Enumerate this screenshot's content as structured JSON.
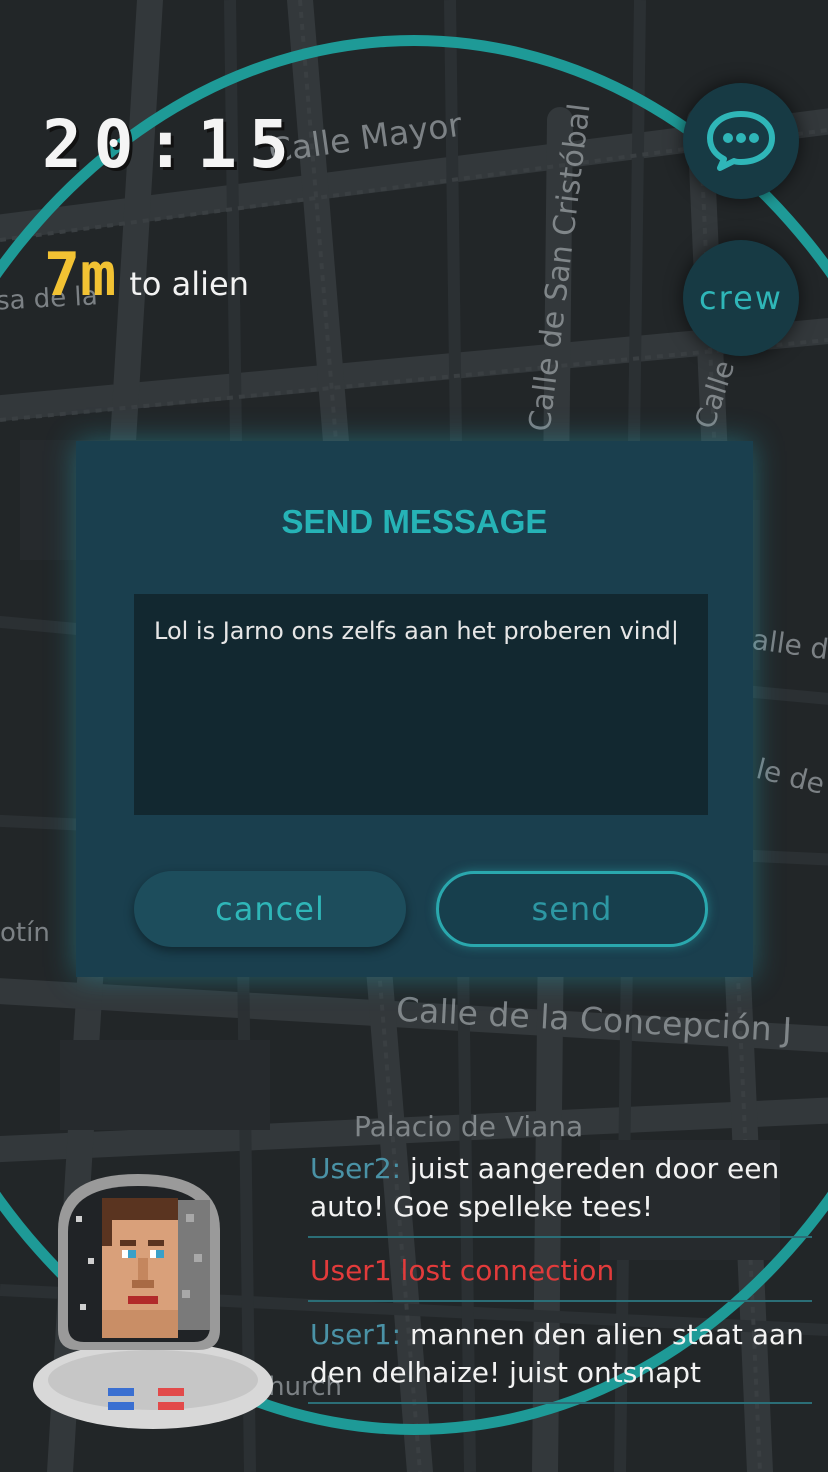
{
  "status": {
    "time": "20:15",
    "distance_value": "7m",
    "distance_label": "to alien"
  },
  "map": {
    "street_labels": [
      "Calle Mayor",
      "Calle de San Cristóbal",
      "Calle",
      "sa de la",
      "Calle de la Concepción J",
      "Palacio de Viana",
      "otín",
      "alle d",
      "le de",
      "Church"
    ]
  },
  "buttons": {
    "chat_icon": "chat-bubble-icon",
    "crew_label": "crew"
  },
  "dialog": {
    "title": "SEND MESSAGE",
    "message_value": "Lol is Jarno ons zelfs aan het proberen vind|",
    "cancel_label": "cancel",
    "send_label": "send"
  },
  "chat": [
    {
      "user": "User2:",
      "text": " juist aangereden door een auto! Goe spelleke tees!"
    },
    {
      "alert": "User1 lost connection"
    },
    {
      "user": "User1:",
      "text": " mannen den alien staat aan  den delhaize! juist ontsnapt"
    }
  ],
  "avatar": {
    "icon": "astronaut-avatar-icon"
  },
  "colors": {
    "accent": "#26b3b6",
    "ring": "#1e9a97",
    "distance": "#f2c233",
    "alert": "#e23b3b",
    "dialog_bg": "#1a3f4e"
  }
}
